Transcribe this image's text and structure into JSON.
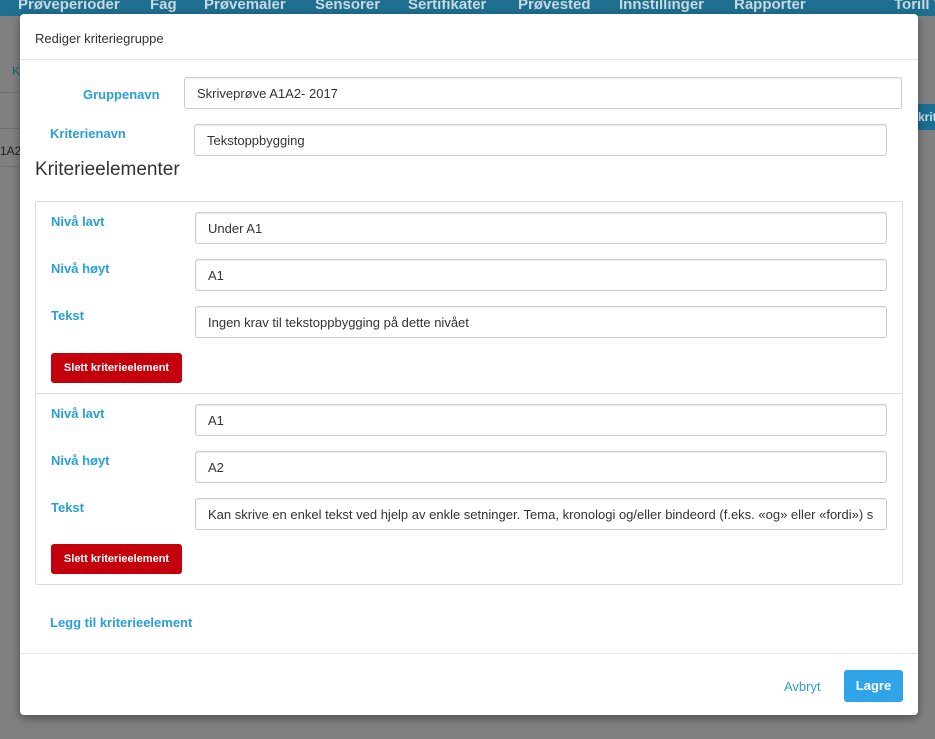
{
  "background": {
    "nav_items": [
      "Prøveperioder",
      "Fag",
      "Prøvemaler",
      "Sensorer",
      "Sertifikater",
      "Prøvested",
      "Innstillinger",
      "Rapporter",
      "Torill V"
    ],
    "left_fragment_1": "K",
    "left_fragment_2": "1A2",
    "right_button_fragment": "krite"
  },
  "modal": {
    "title": "Rediger kriteriegruppe",
    "group_name_label": "Gruppenavn",
    "group_name_value": "Skriveprøve A1A2- 2017",
    "criterion_name_label": "Kriterienavn",
    "criterion_name_value": "Tekstoppbygging",
    "elements_heading": "Kriterieelementer",
    "elements": [
      {
        "low_label": "Nivå lavt",
        "low_value": "Under A1",
        "high_label": "Nivå høyt",
        "high_value": "A1",
        "text_label": "Tekst",
        "text_value": "Ingen krav til tekstoppbygging på dette nivået",
        "delete_label": "Slett kriterieelement"
      },
      {
        "low_label": "Nivå lavt",
        "low_value": "A1",
        "high_label": "Nivå høyt",
        "high_value": "A2",
        "text_label": "Tekst",
        "text_value": "Kan skrive en enkel tekst ved hjelp av enkle setninger. Tema, kronologi og/eller bindeord (f.eks. «og» eller «fordi») skaper",
        "delete_label": "Slett kriterieelement"
      }
    ],
    "add_element_label": "Legg til kriterieelement",
    "cancel_label": "Avbryt",
    "save_label": "Lagre"
  },
  "colors": {
    "accent": "#2a9fd6",
    "primary_button": "#2fa4e7",
    "danger_button": "#c5000d",
    "backdrop": "#7d7d7d"
  }
}
